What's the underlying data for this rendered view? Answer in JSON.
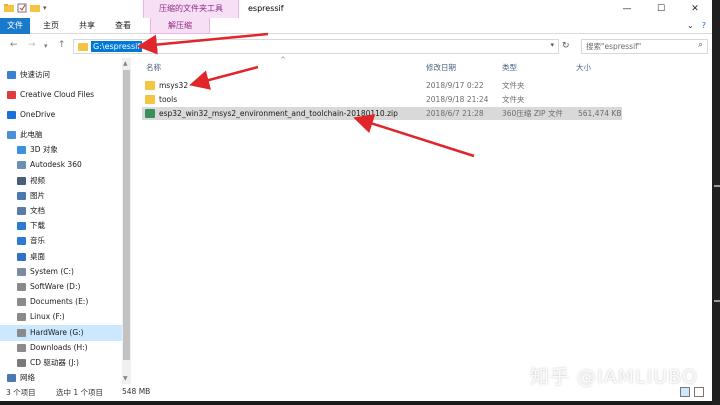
{
  "titlebar": {
    "context_group": "压缩的文件夹工具",
    "title": "espressif",
    "controls": [
      "—",
      "☐",
      "✕"
    ]
  },
  "ribbon": {
    "tabs": [
      "文件",
      "主页",
      "共享",
      "查看"
    ],
    "context_tab": "解压缩",
    "right_icons": [
      "⌄",
      "?"
    ]
  },
  "address": {
    "path": "G:\\espressif",
    "search_placeholder": "搜索\"espressif\""
  },
  "nav_pane": {
    "items": [
      {
        "label": "快速访问",
        "color": "#3b7fd4"
      },
      {
        "label": "Creative Cloud Files",
        "color": "#e23b3b"
      },
      {
        "label": "OneDrive",
        "color": "#1e6fd9"
      },
      {
        "label": "此电脑",
        "color": "#4a90d9"
      },
      {
        "label": "3D 对象",
        "color": "#3d8fe0"
      },
      {
        "label": "Autodesk 360",
        "color": "#6b8fb5"
      },
      {
        "label": "视频",
        "color": "#4a5e7a"
      },
      {
        "label": "图片",
        "color": "#4a78b0"
      },
      {
        "label": "文档",
        "color": "#5a7da8"
      },
      {
        "label": "下载",
        "color": "#2d7ad6"
      },
      {
        "label": "音乐",
        "color": "#2d7ad6"
      },
      {
        "label": "桌面",
        "color": "#2f73c9"
      },
      {
        "label": "System (C:)",
        "color": "#7d8aa0"
      },
      {
        "label": "SoftWare (D:)",
        "color": "#8a8a8a"
      },
      {
        "label": "Documents (E:)",
        "color": "#8a8a8a"
      },
      {
        "label": "Linux (F:)",
        "color": "#8a8a8a"
      },
      {
        "label": "HardWare (G:)",
        "color": "#8a8a8a"
      },
      {
        "label": "Downloads (H:)",
        "color": "#8a8a8a"
      },
      {
        "label": "CD 驱动器 (J:)",
        "color": "#7a7a7a"
      },
      {
        "label": "网络",
        "color": "#4a78b0"
      }
    ],
    "selected_index": 16
  },
  "columns": [
    "名称",
    "修改日期",
    "类型",
    "大小"
  ],
  "files": [
    {
      "name": "msys32",
      "date": "2018/9/17 0:22",
      "type": "文件夹",
      "size": "",
      "icon_color": "#f4c542"
    },
    {
      "name": "tools",
      "date": "2018/9/18 21:24",
      "type": "文件夹",
      "size": "",
      "icon_color": "#f4c542"
    },
    {
      "name": "esp32_win32_msys2_environment_and_toolchain-20180110.zip",
      "date": "2018/6/7 21:28",
      "type": "360压缩 ZIP 文件",
      "size": "561,474 KB",
      "icon_color": "#3a8f5c"
    }
  ],
  "status": {
    "item_count": "3 个项目",
    "selected": "选中 1 个项目",
    "selected_size": "548 MB"
  },
  "watermark": "知乎 @IAMLIUBO",
  "annotation_color": "#e0262b"
}
